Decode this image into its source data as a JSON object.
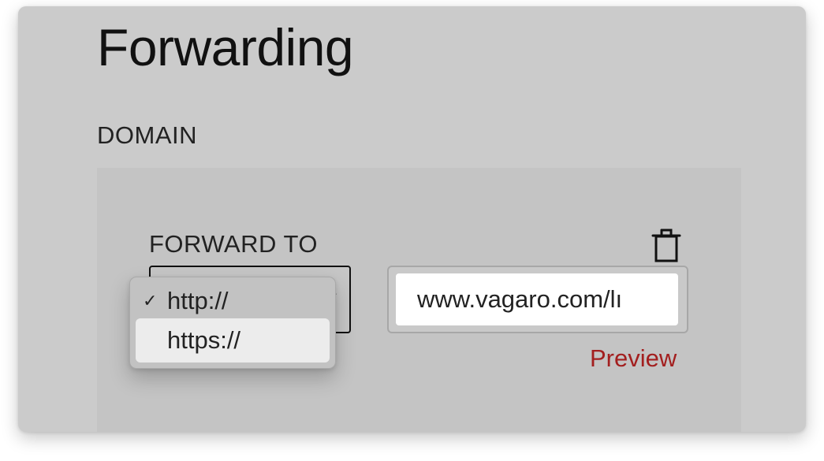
{
  "page": {
    "title": "Forwarding",
    "section_label": "DOMAIN"
  },
  "forwarding_card": {
    "field_label": "FORWARD TO",
    "delete_icon": "trash-icon",
    "protocol_select": {
      "selected": "http://",
      "options": [
        {
          "label": "http://",
          "checked": true,
          "highlighted": false
        },
        {
          "label": "https://",
          "checked": false,
          "highlighted": true
        }
      ],
      "check_mark": "✓",
      "chevron_icon": "chevron-down-icon"
    },
    "url_input": {
      "value": "www.vagaro.com/lı"
    },
    "preview_link": "Preview"
  },
  "colors": {
    "window_background": "#cbcbcb",
    "card_background": "#c4c4c4",
    "preview_link": "#a31f1f",
    "highlighted_option": "#ececec"
  }
}
